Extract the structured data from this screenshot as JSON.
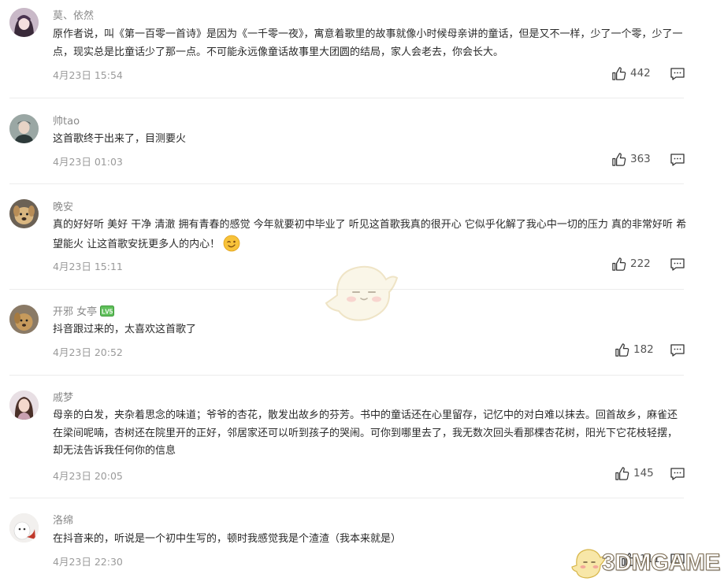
{
  "comments": [
    {
      "username": "莫、依然",
      "text": "原作者说，叫《第一百零一首诗》是因为《一千零一夜》，寓意着歌里的故事就像小时候母亲讲的童话，但是又不一样，少了一个零，少了一点，现实总是比童话少了那一点。不可能永远像童话故事里大团圆的结局，家人会老去，你会长大。",
      "time": "4月23日 15:54",
      "likes": "442"
    },
    {
      "username": "帅tao",
      "text": "这首歌终于出来了，目测要火",
      "time": "4月23日 01:03",
      "likes": "363"
    },
    {
      "username": "晚安",
      "text": "真的好好听 美好 干净 清澈 拥有青春的感觉 今年就要初中毕业了 听见这首歌我真的很开心 它似乎化解了我心中一切的压力 真的非常好听 希望能火 让这首歌安抚更多人的内心！",
      "time": "4月23日 15:11",
      "likes": "222"
    },
    {
      "username": "开邪 女亭",
      "badge": "LV5",
      "text": "抖音跟过来的，太喜欢这首歌了",
      "time": "4月23日 20:52",
      "likes": "182"
    },
    {
      "username": "戚梦",
      "text": "母亲的白发，夹杂着思念的味道；爷爷的杏花，散发出故乡的芬芳。书中的童话还在心里留存，记忆中的对白难以抹去。回首故乡，麻雀还在梁间呢喃，杏树还在院里开的正好，邻居家还可以听到孩子的哭闹。可你到哪里去了，我无数次回头看那棵杏花树，阳光下它花枝轻摆，却无法告诉我任何你的信息",
      "time": "4月23日 20:05",
      "likes": "145"
    },
    {
      "username": "洛绵",
      "text": "在抖音来的，听说是一个初中生写的，顿时我感觉我是个渣渣（我本来就是）",
      "time": "4月23日 22:30",
      "likes": "111"
    }
  ],
  "watermark": "3DMGAME",
  "icons": {
    "like": "thumbs-up-icon",
    "reply": "comment-icon",
    "emoji": "wink-emoji-icon"
  }
}
